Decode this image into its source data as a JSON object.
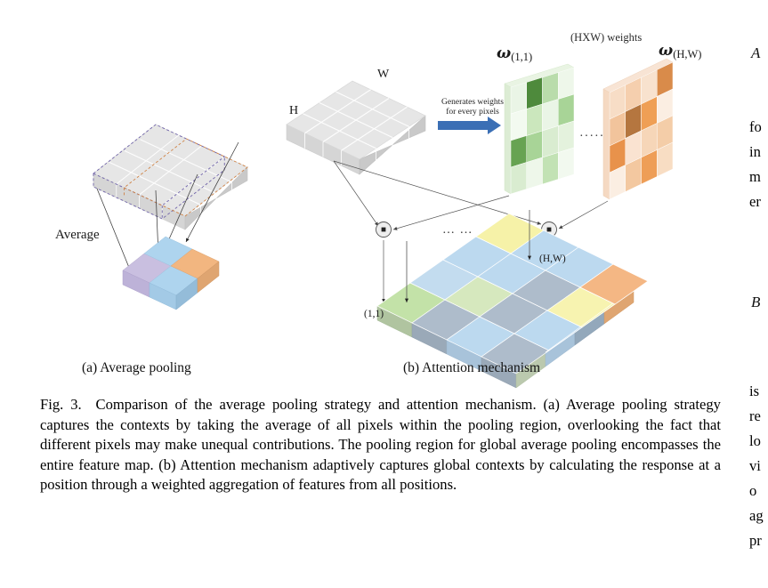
{
  "figure": {
    "subfigure_a": {
      "caption": "(a) Average pooling",
      "average_label": "Average",
      "pooling_regions": [
        {
          "name": "purple-dashed-region",
          "color": "#7b6fb0"
        },
        {
          "name": "orange-dashed-region",
          "color": "#d98b4a"
        }
      ],
      "output_cells": [
        {
          "color": "#c9bfe0",
          "name": "purple"
        },
        {
          "color": "#aed4ee",
          "name": "blue"
        },
        {
          "color": "#aed4ee",
          "name": "blue"
        },
        {
          "color": "#f2b680",
          "name": "orange"
        }
      ],
      "slab_fill": "#e2e2e2"
    },
    "subfigure_b": {
      "caption": "(b) Attention mechanism",
      "input_labels": {
        "height": "H",
        "width": "W"
      },
      "arrow_label": "Generates weights for every pixels",
      "arrow_color": "#3b6fb5",
      "weights_title": "(HXW) weights",
      "weight_maps": [
        {
          "label_symbol": "ω",
          "label_subscript": "(1,1)",
          "palette": "green",
          "cells": [
            [
              "#eaf5e6",
              "#4e8a3c",
              "#b9dcab",
              "#eef7ea"
            ],
            [
              "#f3faf0",
              "#cbe7bd",
              "#eaf5e6",
              "#a8d497"
            ],
            [
              "#67a352",
              "#a8d497",
              "#d9ecd0",
              "#e4f2dd"
            ],
            [
              "#d9ecd0",
              "#eef7ea",
              "#c2e2b4",
              "#f2f9ef"
            ]
          ]
        },
        {
          "label_symbol": "ω",
          "label_subscript": "(H,W)",
          "palette": "orange",
          "cells": [
            [
              "#f7ddc6",
              "#f5cfae",
              "#f8e2ce",
              "#d98b4a"
            ],
            [
              "#f2c49c",
              "#b5763f",
              "#ef9f55",
              "#fbeee2"
            ],
            [
              "#e8924b",
              "#fae3d1",
              "#f6d6b8",
              "#f4cda8"
            ],
            [
              "#fbeee2",
              "#f3c8a0",
              "#ee9e57",
              "#f8ddc3"
            ]
          ]
        }
      ],
      "dots_between_maps": "·····",
      "dots_between_ops": "… …",
      "operator_symbol": "⊙",
      "output_labels": {
        "first": "(1,1)",
        "last": "(H,W)"
      },
      "output_cells": [
        [
          "#c3e2a8",
          "#f6f2a8",
          "#bcd9ef",
          "#bcd9ef",
          "#f4b784"
        ],
        [
          "#bcd9ef",
          "#bcd9ef",
          "#aebccb",
          "#f7f3b0",
          "#bcd9ef"
        ],
        [
          "#c3dcef",
          "#d6e8be",
          "#aebccb",
          "#bcd9ef",
          "#bcd9ef"
        ],
        [
          "#c3e2a8",
          "#aebccb",
          "#bcd9ef",
          "#aebccb",
          "#cfe0c1"
        ]
      ]
    }
  },
  "caption": {
    "figure_number": "Fig. 3.",
    "title": "Comparison of the average pooling strategy and attention mechanism.",
    "body": "(a) Average pooling strategy captures the contexts by taking the average of all pixels within the pooling region, overlooking the fact that different pixels may make unequal contributions. The pooling region for global average pooling encompasses the entire feature map. (b) Attention mechanism adaptively captures global contexts by calculating the response at a position through a weighted aggregation of features from all positions."
  },
  "right_column": {
    "heading_a": "A",
    "heading_b": "B",
    "lines_a": [
      "fo",
      "in",
      "m",
      "er"
    ],
    "lines_b": [
      "is",
      "re",
      "lo",
      "vi",
      "o",
      "ag",
      "pr"
    ]
  }
}
